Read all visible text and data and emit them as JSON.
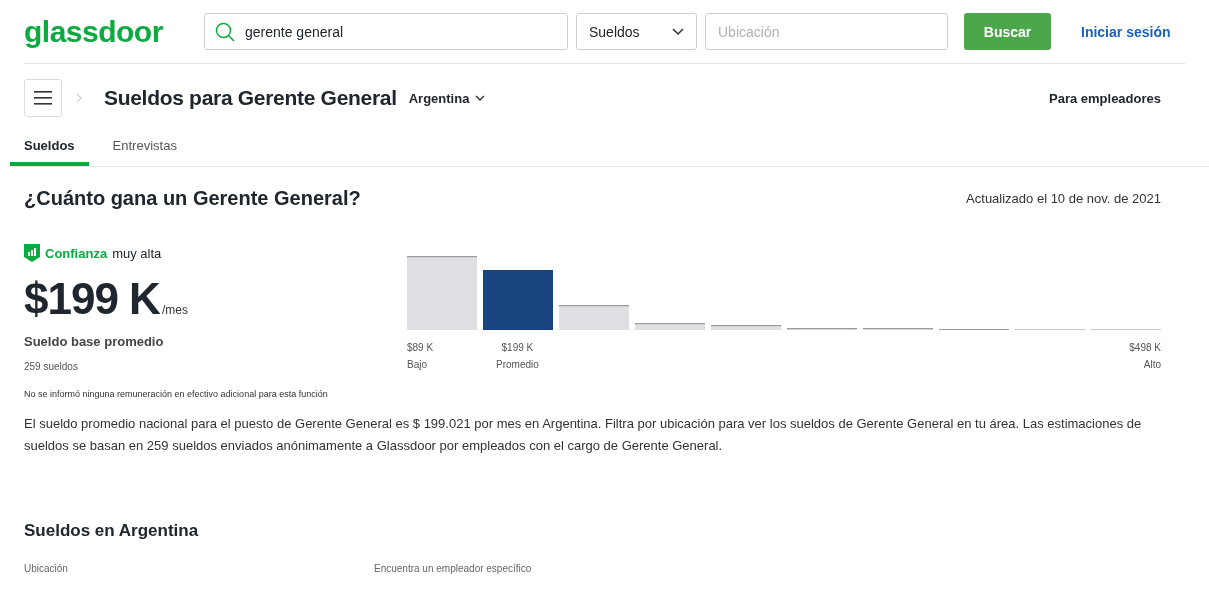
{
  "header": {
    "logo": "glassdoor",
    "search": {
      "value": "gerente general"
    },
    "category": {
      "value": "Sueldos"
    },
    "location": {
      "placeholder": "Ubicación"
    },
    "search_button": "Buscar",
    "login_link": "Iniciar sesión"
  },
  "subheader": {
    "title": "Sueldos para Gerente General",
    "country": "Argentina",
    "employers_link": "Para empleadores"
  },
  "tabs": [
    {
      "label": "Sueldos",
      "selected": true
    },
    {
      "label": "Entrevistas",
      "selected": false
    }
  ],
  "summary": {
    "heading": "¿Cuánto gana un Gerente General?",
    "updated": "Actualizado el 10 de nov. de 2021",
    "confidence_label": "Confianza",
    "confidence_level": "muy alta",
    "amount": "$199 K",
    "unit": "/mes",
    "amount_label": "Sueldo base promedio",
    "count": "259 sueldos",
    "note": "No se informó ninguna remuneración en efectivo adicional para esta función",
    "histogram": {
      "kind": "picture",
      "labels": [
        {
          "value": "$89 K",
          "caption": "Bajo"
        },
        {
          "value": "$199 K",
          "caption": "Promedio"
        },
        {
          "value": "$498 K",
          "caption": "Alto"
        }
      ]
    },
    "description": "El sueldo promedio nacional para el puesto de Gerente General es $ 199.021 por mes en Argentina. Filtra por ubicación para ver los sueldos de Gerente General en tu área. Las estimaciones de sueldos se basan en 259 sueldos enviados anónimamente a Glassdoor por empleados con el cargo de Gerente General."
  },
  "section": {
    "heading": "Sueldos en Argentina",
    "field_labels": [
      "Ubicación",
      "Encuentra un empleador específico"
    ]
  }
}
